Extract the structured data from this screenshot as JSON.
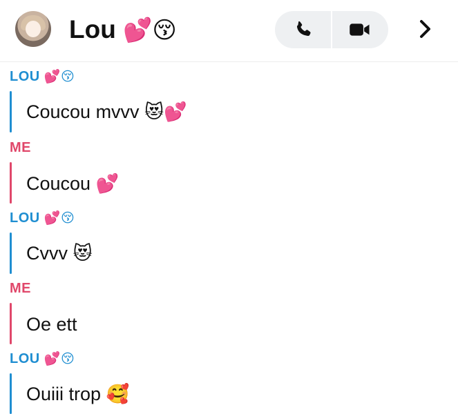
{
  "header": {
    "contact_name": "Lou",
    "name_emojis": "💕😚",
    "call_icon": "phone-icon",
    "video_icon": "video-camera-icon",
    "more_icon": "chevron-right-icon"
  },
  "colors": {
    "contact_accent": "#1f8ed1",
    "me_accent": "#e0476a",
    "call_group_bg": "#eef0f2"
  },
  "messages": [
    {
      "sender": "LOU",
      "sender_emojis": "💕😚",
      "text": "Coucou mvvv 😻💕"
    },
    {
      "sender": "ME",
      "sender_emojis": "",
      "text": "Coucou 💕"
    },
    {
      "sender": "LOU",
      "sender_emojis": "💕😚",
      "text": "Cvvv 😻"
    },
    {
      "sender": "ME",
      "sender_emojis": "",
      "text": "Oe ett"
    },
    {
      "sender": "LOU",
      "sender_emojis": "💕😚",
      "text": "Ouiii trop 🥰"
    }
  ]
}
